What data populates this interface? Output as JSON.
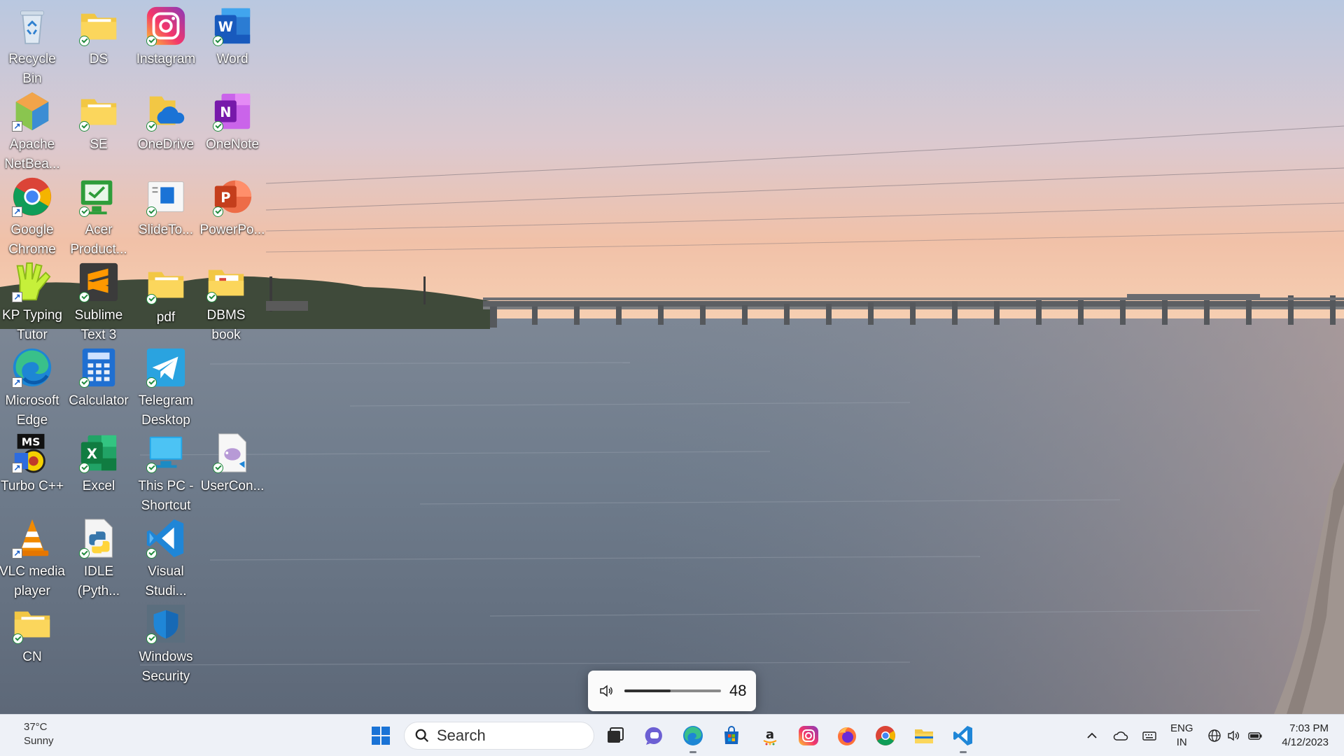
{
  "desktop": {
    "icons": [
      {
        "label": "Recycle Bin",
        "icon": "recycle-bin-icon"
      },
      {
        "label": "DS",
        "icon": "folder-icon"
      },
      {
        "label": "Instagram",
        "icon": "instagram-icon"
      },
      {
        "label": "Word",
        "icon": "word-icon"
      },
      {
        "label": "Apache NetBea...",
        "icon": "netbeans-icon"
      },
      {
        "label": "SE",
        "icon": "folder-icon"
      },
      {
        "label": "OneDrive",
        "icon": "onedrive-icon"
      },
      {
        "label": "OneNote",
        "icon": "onenote-icon"
      },
      {
        "label": "Google Chrome",
        "icon": "chrome-icon"
      },
      {
        "label": "Acer Product...",
        "icon": "acer-icon"
      },
      {
        "label": "SlideTo...",
        "icon": "slideto-icon"
      },
      {
        "label": "PowerPo...",
        "icon": "powerpoint-icon"
      },
      {
        "label": "KP Typing Tutor",
        "icon": "kp-typing-icon"
      },
      {
        "label": "Sublime Text 3",
        "icon": "sublime-icon"
      },
      {
        "label": "pdf",
        "icon": "folder-icon"
      },
      {
        "label": "DBMS book",
        "icon": "folder-icon"
      },
      {
        "label": "Microsoft Edge",
        "icon": "edge-icon"
      },
      {
        "label": "Calculator",
        "icon": "calculator-icon"
      },
      {
        "label": "Telegram Desktop",
        "icon": "telegram-icon"
      },
      {
        "label": "Turbo C++",
        "icon": "turbo-cpp-icon"
      },
      {
        "label": "Excel",
        "icon": "excel-icon"
      },
      {
        "label": "This PC - Shortcut",
        "icon": "this-pc-icon"
      },
      {
        "label": "UserCon...",
        "icon": "php-file-icon"
      },
      {
        "label": "VLC media player",
        "icon": "vlc-icon"
      },
      {
        "label": "IDLE (Pyth...",
        "icon": "python-idle-icon"
      },
      {
        "label": "Visual Studi...",
        "icon": "vscode-icon"
      },
      {
        "label": "CN",
        "icon": "folder-icon"
      },
      {
        "label": "Windows Security",
        "icon": "windows-security-icon"
      }
    ]
  },
  "volume": {
    "level": "48",
    "fraction": 0.48
  },
  "taskbar": {
    "weather": {
      "temp": "37°C",
      "condition": "Sunny"
    },
    "search_placeholder": "Search",
    "apps": [
      "start-icon",
      "search",
      "task-view-icon",
      "teams-chat-icon",
      "edge-icon",
      "microsoft-store-icon",
      "amazon-icon",
      "instagram-icon",
      "firefox-icon",
      "chrome-icon",
      "file-explorer-icon",
      "vscode-icon"
    ],
    "tray": {
      "language": "ENG",
      "region": "IN",
      "time": "7:03 PM",
      "date": "4/12/2023"
    }
  }
}
